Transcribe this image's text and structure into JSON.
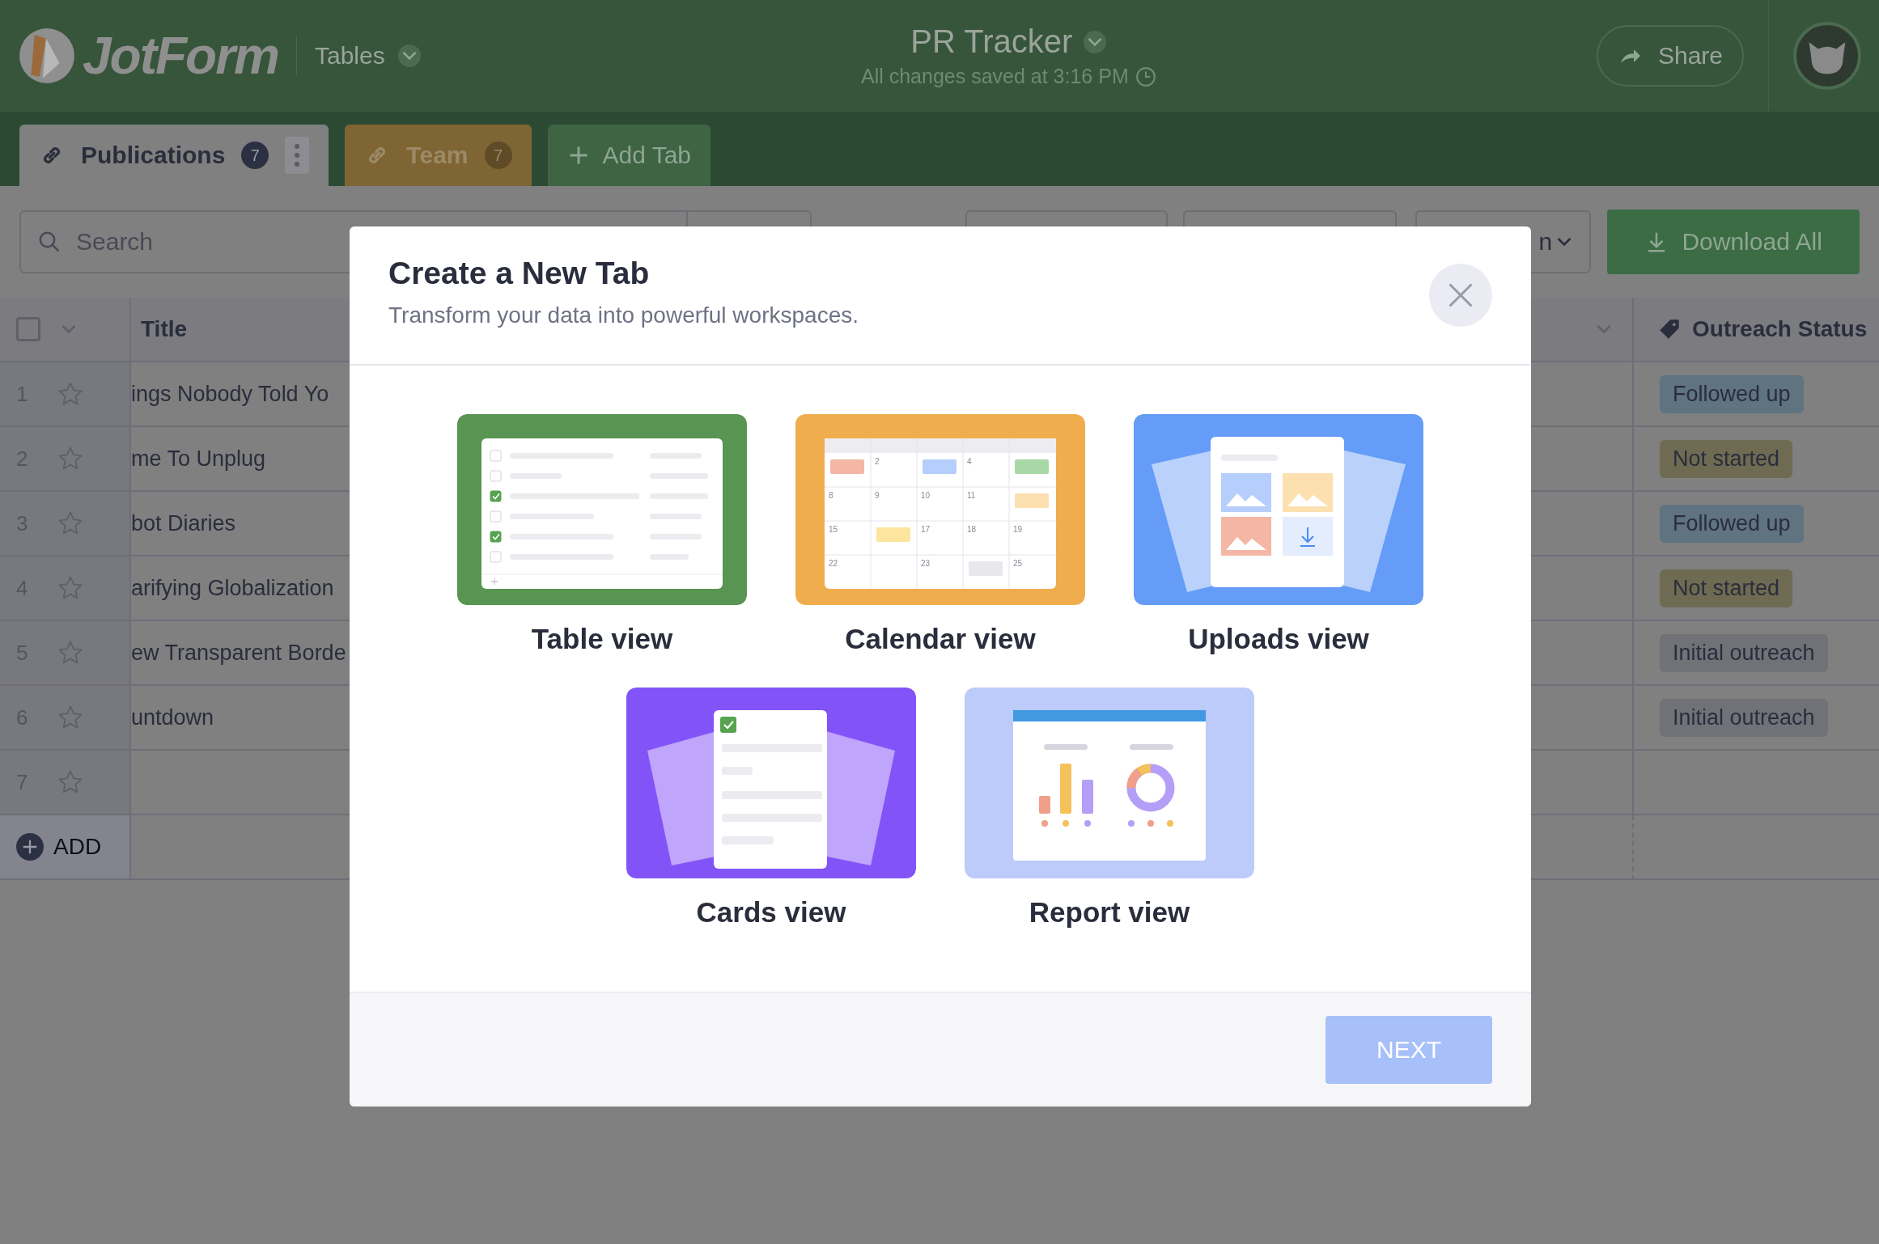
{
  "header": {
    "logo": "JotForm",
    "app_menu": "Tables",
    "title": "PR Tracker",
    "saved_status": "All changes saved at 3:16 PM",
    "share_button": "Share"
  },
  "tabs": [
    {
      "label": "Publications",
      "count": "7",
      "selected": true
    },
    {
      "label": "Team",
      "count": "7",
      "selected": false
    }
  ],
  "add_tab_button": "Add Tab",
  "toolbar": {
    "search": {
      "placeholder": "Search"
    },
    "view_select": {
      "value": "n"
    },
    "download_button": "Download All"
  },
  "table": {
    "select_all": {
      "checked": false
    },
    "columns": [
      {
        "label": "Title"
      },
      {
        "label": "Outreach Status"
      }
    ],
    "rows": [
      {
        "number": "1",
        "starred": false,
        "title": "ings Nobody Told Yo",
        "status": {
          "label": "Followed up",
          "color": "#5f7380"
        }
      },
      {
        "number": "2",
        "starred": false,
        "title": "me To Unplug",
        "status": {
          "label": "Not started",
          "color": "#6e6b52"
        }
      },
      {
        "number": "3",
        "starred": false,
        "title": "bot Diaries",
        "status": {
          "label": "Followed up",
          "color": "#5f7380"
        }
      },
      {
        "number": "4",
        "starred": false,
        "title": "arifying Globalization",
        "status": {
          "label": "Not started",
          "color": "#6e6b52"
        }
      },
      {
        "number": "5",
        "starred": false,
        "title": "ew Transparent Borde",
        "status": {
          "label": "Initial outreach",
          "color": "#717178"
        }
      },
      {
        "number": "6",
        "starred": false,
        "title": "untdown",
        "status": {
          "label": "Initial outreach",
          "color": "#717178"
        }
      },
      {
        "number": "7",
        "starred": false
      }
    ],
    "add_button": "ADD"
  },
  "modal": {
    "title": "Create a New Tab",
    "subtitle": "Transform your data into powerful workspaces.",
    "options": [
      {
        "kind": "table",
        "label": "Table view",
        "selected": false
      },
      {
        "kind": "calendar",
        "label": "Calendar view",
        "selected": false,
        "days": [
          "2",
          "4",
          "8",
          "9",
          "10",
          "11",
          "15",
          "17",
          "18",
          "19",
          "22",
          "23",
          "25"
        ]
      },
      {
        "kind": "uploads",
        "label": "Uploads view",
        "selected": false
      },
      {
        "kind": "cards",
        "label": "Cards view",
        "selected": false
      },
      {
        "kind": "report",
        "label": "Report view",
        "selected": false
      }
    ],
    "next_button": {
      "label": "NEXT",
      "disabled": true
    }
  }
}
